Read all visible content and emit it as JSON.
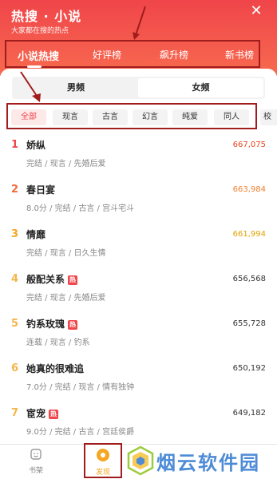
{
  "header": {
    "title": "热搜 · 小说",
    "subtitle": "大家都在搜的热点"
  },
  "tabs": [
    {
      "label": "小说热搜",
      "active": true
    },
    {
      "label": "好评榜",
      "active": false
    },
    {
      "label": "飙升榜",
      "active": false
    },
    {
      "label": "新书榜",
      "active": false
    }
  ],
  "gender": {
    "male": "男频",
    "female": "女频",
    "selected": "女频"
  },
  "categories": [
    {
      "label": "全部",
      "active": true
    },
    {
      "label": "现言",
      "active": false
    },
    {
      "label": "古言",
      "active": false
    },
    {
      "label": "幻言",
      "active": false
    },
    {
      "label": "纯爱",
      "active": false
    },
    {
      "label": "同人",
      "active": false
    },
    {
      "label": "校园",
      "active": false
    }
  ],
  "books": [
    {
      "rank": "1",
      "title": "娇纵",
      "hot": false,
      "meta": "完结 / 现言 / 先婚后爱",
      "count": "667,075"
    },
    {
      "rank": "2",
      "title": "春日宴",
      "hot": false,
      "meta": "8.0分 / 完结 / 古言 / 宫斗宅斗",
      "count": "663,984"
    },
    {
      "rank": "3",
      "title": "情靡",
      "hot": false,
      "meta": "完结 / 现言 / 日久生情",
      "count": "661,994"
    },
    {
      "rank": "4",
      "title": "般配关系",
      "hot": true,
      "meta": "完结 / 现言 / 先婚后爱",
      "count": "656,568"
    },
    {
      "rank": "5",
      "title": "钓系玫瑰",
      "hot": true,
      "meta": "连载 / 现言 / 钓系",
      "count": "655,728"
    },
    {
      "rank": "6",
      "title": "她真的很难追",
      "hot": false,
      "meta": "7.0分 / 完结 / 现言 / 情有独钟",
      "count": "650,192"
    },
    {
      "rank": "7",
      "title": "宦宠",
      "hot": true,
      "meta": "9.0分 / 完结 / 古言 / 宫廷侯爵",
      "count": "649,182"
    }
  ],
  "hot_label": "热",
  "bottom_nav": {
    "bookshelf": "书架",
    "discover": "发现"
  },
  "watermark": "烟云软件园",
  "colors": {
    "brand": "#f0454a",
    "rank_top3": "#f0454a",
    "rank_orange": "#f5a623",
    "count_top": "#e8441f",
    "count_orange": "#e0a300",
    "annotation": "#a11c1c"
  }
}
